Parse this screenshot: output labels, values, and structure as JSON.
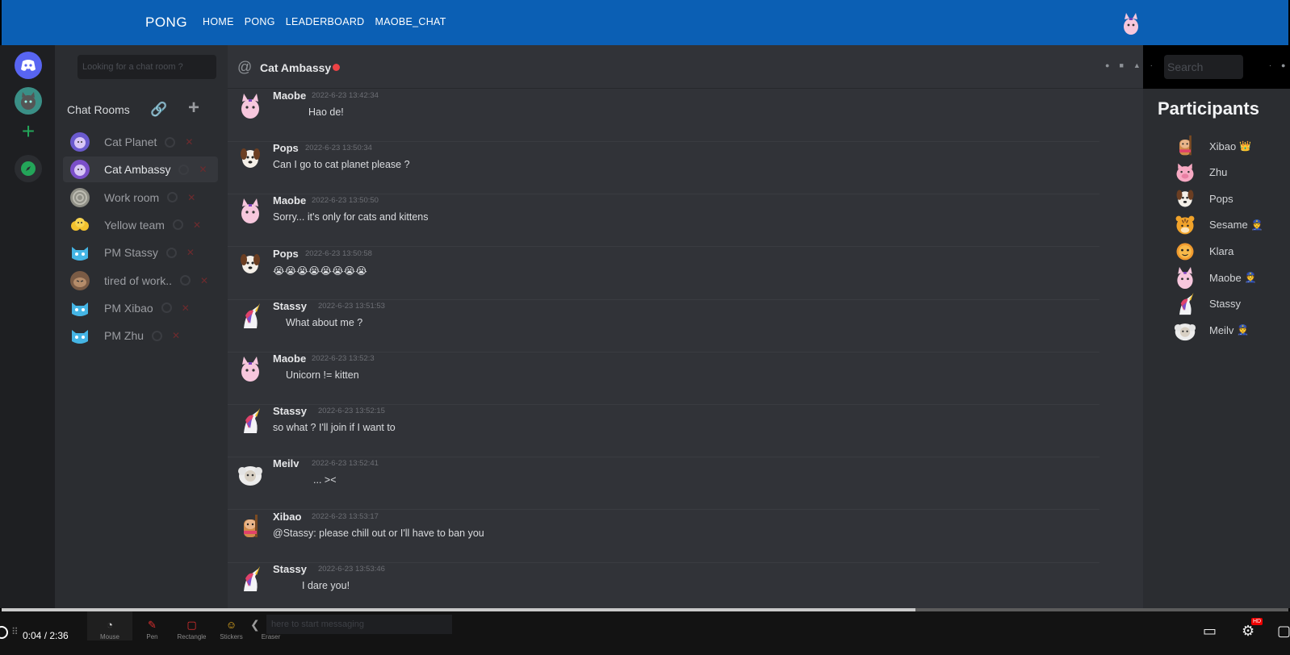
{
  "nav": {
    "brand": "PONG",
    "links": [
      "HOME",
      "PONG",
      "LEADERBOARD",
      "MAOBE_CHAT"
    ]
  },
  "rooms": {
    "search_placeholder": "Looking for a chat room ?",
    "heading": "Chat Rooms",
    "items": [
      {
        "name": "Cat Planet",
        "icon": "cat-planet-icon",
        "color": "#6a5acd",
        "active": false
      },
      {
        "name": "Cat Ambassy",
        "icon": "cat-ambassy-icon",
        "color": "#7b4fc9",
        "active": true
      },
      {
        "name": "Work room",
        "icon": "work-room-icon",
        "color": "#8f8f86",
        "active": false
      },
      {
        "name": "Yellow team",
        "icon": "yellow-team-icon",
        "color": "#f2c12e",
        "active": false
      },
      {
        "name": "PM Stassy",
        "icon": "pm-cat-icon",
        "color": "#45b5e5",
        "active": false
      },
      {
        "name": "tired of work..",
        "icon": "tired-icon",
        "color": "#7a5b45",
        "active": false
      },
      {
        "name": "PM Xibao",
        "icon": "pm-cat-icon",
        "color": "#45b5e5",
        "active": false
      },
      {
        "name": "PM Zhu",
        "icon": "pm-cat-icon",
        "color": "#45b5e5",
        "active": false
      }
    ]
  },
  "chat": {
    "title": "Cat Ambassy",
    "search_placeholder": "Search",
    "messages": [
      {
        "user": "Maobe",
        "time": "2022-6-23 13:42:34",
        "text": "Hao de!",
        "avatar": "pink-cat-avatar"
      },
      {
        "user": "Pops",
        "time": "2022-6-23 13:50:34",
        "text": "Can I go to cat planet please ?",
        "avatar": "dog-avatar"
      },
      {
        "user": "Maobe",
        "time": "2022-6-23 13:50:50",
        "text": "Sorry... it's only for cats and kittens",
        "avatar": "pink-cat-avatar"
      },
      {
        "user": "Pops",
        "time": "2022-6-23 13:50:58",
        "text": "😭😭😭😭😭😭😭😭",
        "avatar": "dog-avatar"
      },
      {
        "user": "Stassy",
        "time": "2022-6-23 13:51:53",
        "text": "What about me ?",
        "avatar": "unicorn-avatar"
      },
      {
        "user": "Maobe",
        "time": "2022-6-23 13:52:3",
        "text": "Unicorn != kitten",
        "avatar": "pink-cat-avatar"
      },
      {
        "user": "Stassy",
        "time": "2022-6-23 13:52:15",
        "text": "so what ? I'll join if I want to",
        "avatar": "unicorn-avatar"
      },
      {
        "user": "Meilv",
        "time": "2022-6-23 13:52:41",
        "text": "... ><",
        "avatar": "sheep-avatar"
      },
      {
        "user": "Xibao",
        "time": "2022-6-23 13:53:17",
        "text": "@Stassy: please chill out or I'll have to ban you",
        "avatar": "xibao-avatar"
      },
      {
        "user": "Stassy",
        "time": "2022-6-23 13:53:46",
        "text": "I dare you!",
        "avatar": "unicorn-avatar"
      }
    ]
  },
  "participants": {
    "title": "Participants",
    "items": [
      {
        "name": "Xibao",
        "badge": "👑",
        "avatar": "xibao-avatar"
      },
      {
        "name": "Zhu",
        "badge": "",
        "avatar": "pig-avatar"
      },
      {
        "name": "Pops",
        "badge": "",
        "avatar": "dog-avatar"
      },
      {
        "name": "Sesame",
        "badge": "👮",
        "avatar": "tiger-avatar"
      },
      {
        "name": "Klara",
        "badge": "",
        "avatar": "orange-avatar"
      },
      {
        "name": "Maobe",
        "badge": "👮",
        "avatar": "pink-cat-avatar"
      },
      {
        "name": "Stassy",
        "badge": "",
        "avatar": "unicorn-avatar"
      },
      {
        "name": "Meilv",
        "badge": "👮",
        "avatar": "sheep-avatar"
      }
    ]
  },
  "composer": {
    "placeholder": "here to start messaging"
  },
  "video": {
    "time": "0:04 / 2:36",
    "progress": 0.71,
    "tools": [
      {
        "label": "Mouse",
        "icon": "mouse-icon"
      },
      {
        "label": "Pen",
        "icon": "pen-icon"
      },
      {
        "label": "Rectangle",
        "icon": "rectangle-icon"
      },
      {
        "label": "Stickers",
        "icon": "stickers-icon"
      },
      {
        "label": "Eraser",
        "icon": "eraser-icon"
      }
    ],
    "hd_badge": "HD"
  }
}
